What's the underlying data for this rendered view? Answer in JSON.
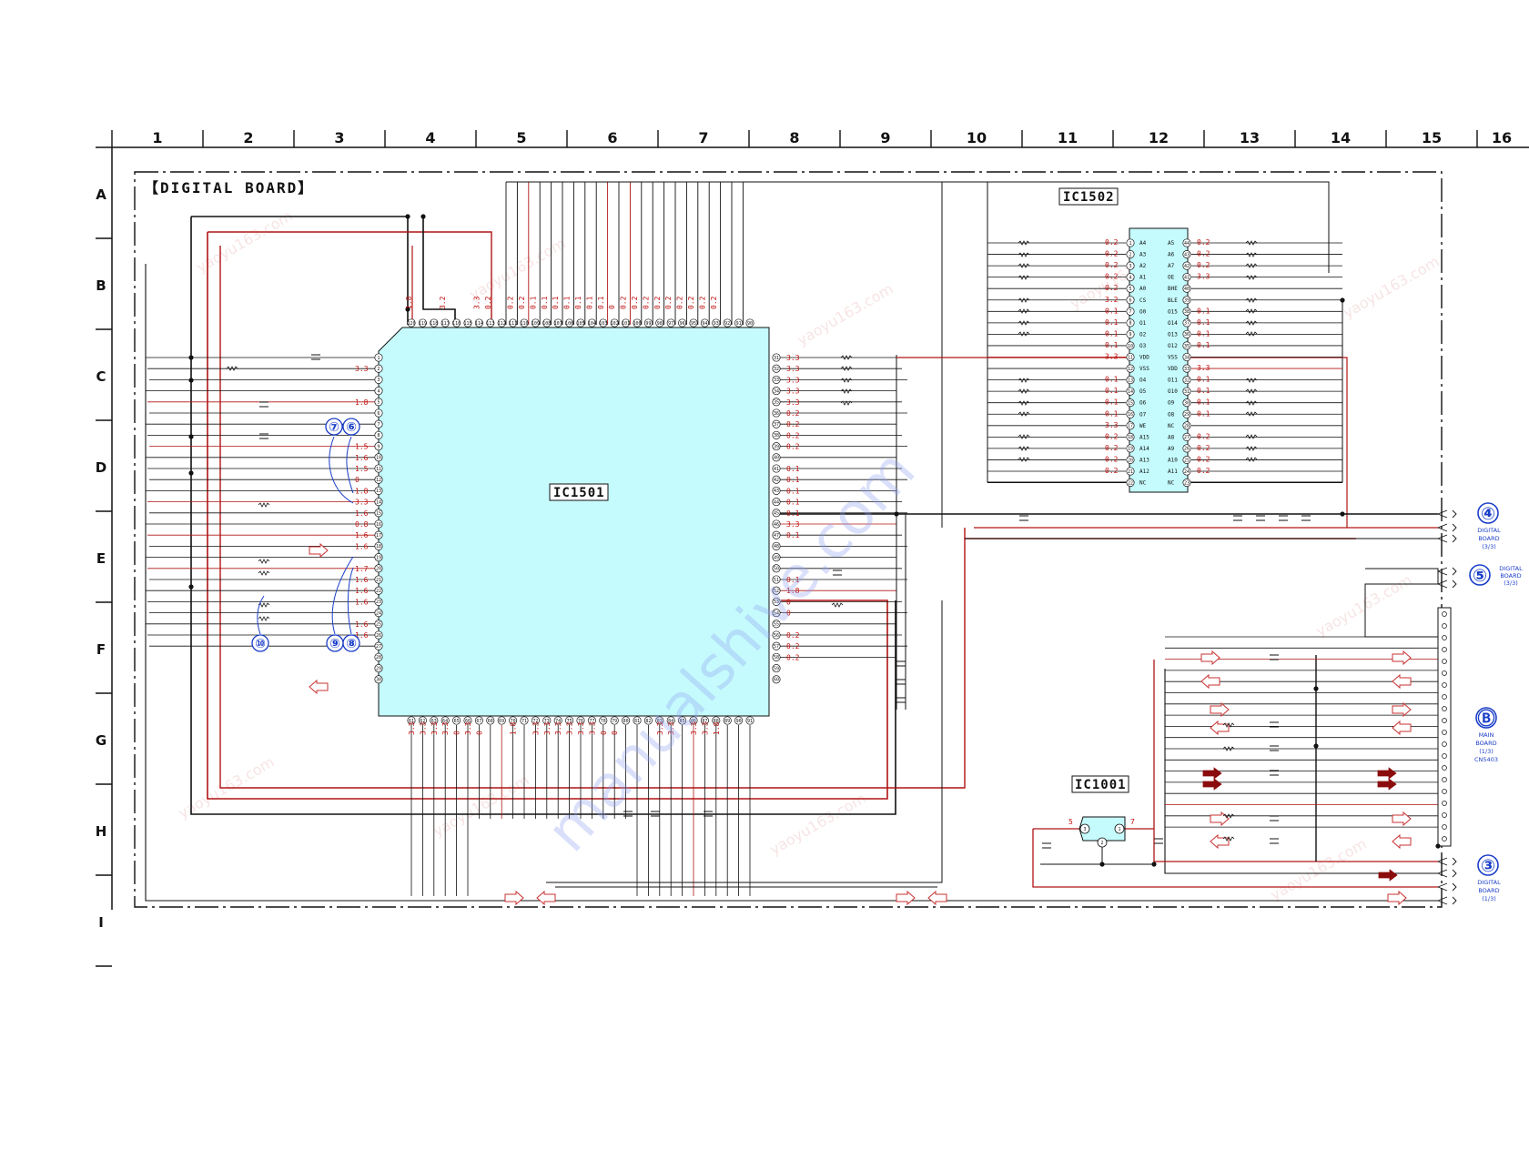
{
  "columns": [
    "1",
    "2",
    "3",
    "4",
    "5",
    "6",
    "7",
    "8",
    "9",
    "10",
    "11",
    "12",
    "13",
    "14",
    "15",
    "16"
  ],
  "rows": [
    "A",
    "B",
    "C",
    "D",
    "E",
    "F",
    "G",
    "H",
    "I"
  ],
  "board_title": "【DIGITAL BOARD】",
  "ic_main": "IC1501",
  "ic_mem": "IC1502",
  "ic_small": "IC1001",
  "watermark": "manualshive.com",
  "watermark_cn": "yaoyu163.com",
  "waveform_markers": [
    {
      "label": "⑦"
    },
    {
      "label": "⑥"
    },
    {
      "label": "⑩"
    },
    {
      "label": "⑨"
    },
    {
      "label": "⑧"
    }
  ],
  "ic1502": {
    "left_pins": [
      {
        "n": "1",
        "name": "A4",
        "v": "0.2"
      },
      {
        "n": "2",
        "name": "A3",
        "v": "0.2"
      },
      {
        "n": "3",
        "name": "A2",
        "v": "0.2"
      },
      {
        "n": "4",
        "name": "A1",
        "v": "0.2"
      },
      {
        "n": "5",
        "name": "A0",
        "v": "0.2"
      },
      {
        "n": "6",
        "name": "CS",
        "v": "3.2"
      },
      {
        "n": "7",
        "name": "O0",
        "v": "0.1"
      },
      {
        "n": "8",
        "name": "O1",
        "v": "0.1"
      },
      {
        "n": "9",
        "name": "O2",
        "v": "0.1"
      },
      {
        "n": "10",
        "name": "O3",
        "v": "0.1"
      },
      {
        "n": "11",
        "name": "VDD",
        "v": "3.3"
      },
      {
        "n": "12",
        "name": "VSS",
        "v": ""
      },
      {
        "n": "13",
        "name": "O4",
        "v": "0.1"
      },
      {
        "n": "14",
        "name": "O5",
        "v": "0.1"
      },
      {
        "n": "15",
        "name": "O6",
        "v": "0.1"
      },
      {
        "n": "16",
        "name": "O7",
        "v": "0.1"
      },
      {
        "n": "17",
        "name": "WE",
        "v": "3.3"
      },
      {
        "n": "18",
        "name": "A15",
        "v": "0.2"
      },
      {
        "n": "19",
        "name": "A14",
        "v": "0.2"
      },
      {
        "n": "20",
        "name": "A13",
        "v": "0.2"
      },
      {
        "n": "21",
        "name": "A12",
        "v": "0.2"
      },
      {
        "n": "22",
        "name": "NC",
        "v": ""
      }
    ],
    "right_pins": [
      {
        "n": "44",
        "name": "A5",
        "v": "0.2"
      },
      {
        "n": "43",
        "name": "A6",
        "v": "0.2"
      },
      {
        "n": "42",
        "name": "A7",
        "v": "0.2"
      },
      {
        "n": "41",
        "name": "OE",
        "v": "3.3"
      },
      {
        "n": "40",
        "name": "BHE",
        "v": ""
      },
      {
        "n": "39",
        "name": "BLE",
        "v": ""
      },
      {
        "n": "38",
        "name": "O15",
        "v": "0.1"
      },
      {
        "n": "37",
        "name": "O14",
        "v": "0.1"
      },
      {
        "n": "36",
        "name": "O13",
        "v": "0.1"
      },
      {
        "n": "35",
        "name": "O12",
        "v": "0.1"
      },
      {
        "n": "34",
        "name": "VSS",
        "v": ""
      },
      {
        "n": "33",
        "name": "VDD",
        "v": "3.3"
      },
      {
        "n": "32",
        "name": "O11",
        "v": "0.1"
      },
      {
        "n": "31",
        "name": "O10",
        "v": "0.1"
      },
      {
        "n": "30",
        "name": "O9",
        "v": "0.1"
      },
      {
        "n": "29",
        "name": "O8",
        "v": "0.1"
      },
      {
        "n": "28",
        "name": "NC",
        "v": ""
      },
      {
        "n": "27",
        "name": "A8",
        "v": "0.2"
      },
      {
        "n": "26",
        "name": "A9",
        "v": "0.2"
      },
      {
        "n": "25",
        "name": "A10",
        "v": "0.2"
      },
      {
        "n": "24",
        "name": "A11",
        "v": "0.2"
      },
      {
        "n": "23",
        "name": "NC",
        "v": ""
      }
    ]
  },
  "ic1501": {
    "left_voltages": [
      "",
      "3.3",
      "",
      "",
      "1.8",
      "",
      "",
      "",
      "1.5",
      "1.6",
      "1.5",
      "0",
      "1.8",
      "3.3",
      "1.6",
      "0.8",
      "1.6",
      "1.6",
      "",
      "1.7",
      "1.6",
      "1.6",
      "1.6",
      "",
      "1.6",
      "1.6",
      "0"
    ],
    "right_voltages": [
      "3.3",
      "3.3",
      "3.3",
      "3.3",
      "3.3",
      "0.2",
      "0.2",
      "0.2",
      "0.2",
      "",
      "0.1",
      "0.1",
      "0.1",
      "0.1",
      "0.1",
      "3.3",
      "0.1",
      "",
      "",
      "",
      "0.1",
      "1.8",
      "0",
      "0",
      "",
      "0.2",
      "0.2",
      "0.2"
    ],
    "top_voltages": [
      "1.8",
      "",
      "",
      "3.2",
      "",
      "",
      "3.3",
      "0.2",
      "",
      "0.2",
      "0.2",
      "0.1",
      "0.1",
      "0.1",
      "0.1",
      "0.1",
      "0.1",
      "0.1",
      "0",
      "0.2",
      "0.2",
      "0.2",
      "0.2",
      "0.2",
      "0.2",
      "0.2",
      "0.2",
      "0.2"
    ],
    "bottom_voltages": [
      "3.3",
      "3.3",
      "3.3",
      "3.3",
      "0",
      "3.3",
      "0",
      "",
      "",
      "1.8",
      "",
      "3.3",
      "3.3",
      "3.3",
      "3.3",
      "3.3",
      "3.3",
      "0",
      "0",
      "",
      "",
      "",
      "3.3",
      "3.3",
      "",
      "3.3",
      "3.3",
      "1.8"
    ]
  },
  "ic1001": {
    "pin_left": "3",
    "pin_bottom": "2",
    "pin_right": "1",
    "v_left": "5",
    "v_right": "7"
  },
  "connectors": [
    {
      "num": "④",
      "lines": [
        "DIGITAL",
        "BOARD",
        "(3/3)"
      ]
    },
    {
      "num": "⑤",
      "lines": [
        "DIGITAL",
        "BOARD",
        "(3/3)"
      ]
    },
    {
      "num": "Ⓑ",
      "lines": [
        "MAIN",
        "BOARD",
        "(1/3)",
        "CN5403"
      ]
    },
    {
      "num": "③",
      "lines": [
        "DIGITAL",
        "BOARD",
        "(1/3)"
      ]
    }
  ],
  "colors": {
    "wire_black": "#111111",
    "wire_red": "#b01414",
    "ic_fill": "#c5fbfd",
    "accent_blue": "#1a3ec8",
    "voltage_red": "#c01010",
    "arrow_red": "#c83232"
  }
}
